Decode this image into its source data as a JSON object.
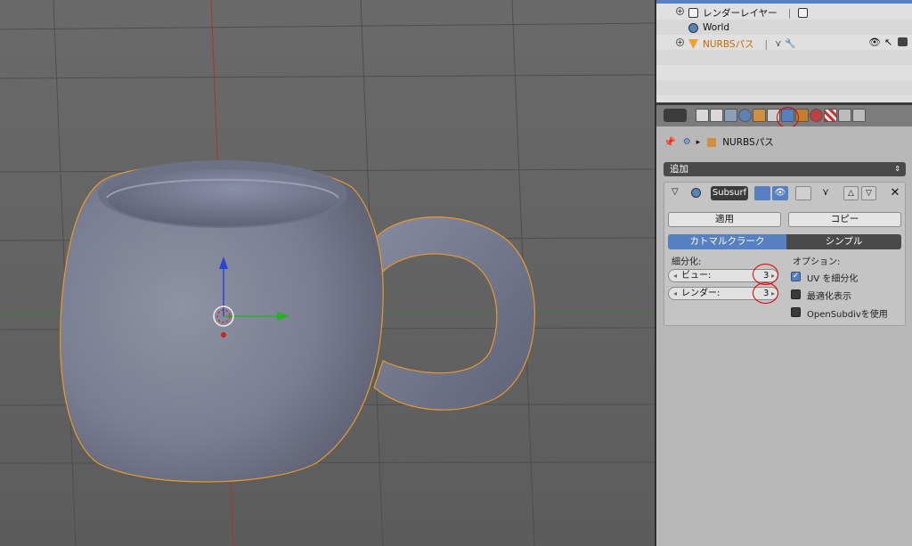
{
  "outliner": {
    "rows": [
      {
        "label": "レンダーレイヤー",
        "kind": "render-layer"
      },
      {
        "label": "World",
        "kind": "world"
      },
      {
        "label": "NURBSパス",
        "kind": "nurbs-path"
      }
    ]
  },
  "properties": {
    "breadcrumb_object": "NURBSパス",
    "add_modifier_label": "追加",
    "modifier": {
      "name": "Subsurf",
      "apply_label": "適用",
      "copy_label": "コピー",
      "type_catmull": "カトマルクラーク",
      "type_simple": "シンプル",
      "subdivisions_label": "細分化:",
      "view_label": "ビュー:",
      "view_value": "3",
      "render_label": "レンダー:",
      "render_value": "3",
      "options_label": "オプション:",
      "uv_subdivide_label": "UV を細分化",
      "uv_subdivide_checked": true,
      "optimal_display_label": "最適化表示",
      "optimal_display_checked": false,
      "opensubdiv_label": "OpenSubdivを使用",
      "opensubdiv_checked": false
    }
  },
  "colors": {
    "accent_blue": "#5680c2",
    "selection_orange": "#e89a2a",
    "annotation_red": "#e00000"
  }
}
